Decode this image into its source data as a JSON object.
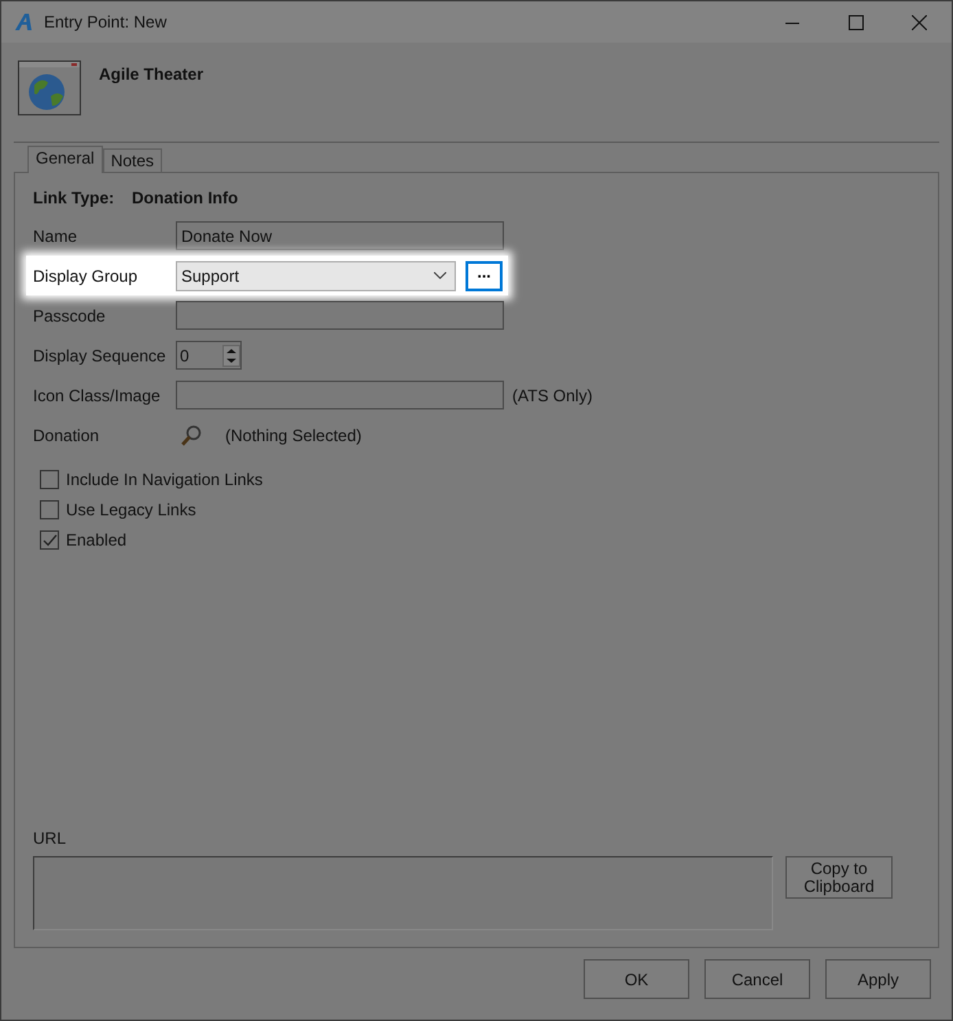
{
  "window": {
    "title": "Entry Point: New"
  },
  "header": {
    "title": "Agile Theater"
  },
  "tabs": [
    {
      "label": "General",
      "selected": true
    },
    {
      "label": "Notes",
      "selected": false
    }
  ],
  "link_type": {
    "label": "Link Type:",
    "value": "Donation Info"
  },
  "fields": [
    {
      "kind": "text",
      "label": "Name",
      "value": "Donate Now",
      "highlighted": false
    },
    {
      "kind": "combo",
      "label": "Display Group",
      "value": "Support",
      "button": "...",
      "highlighted": true
    },
    {
      "kind": "text",
      "label": "Passcode",
      "highlighted": false
    },
    {
      "kind": "spinner",
      "label": "Display Sequence",
      "value": "0",
      "highlighted": false
    },
    {
      "kind": "text",
      "label": "Icon Class/Image",
      "suffix": "(ATS Only)",
      "highlighted": false
    },
    {
      "kind": "lookup",
      "label": "Donation",
      "value": "(Nothing Selected)",
      "highlighted": false
    }
  ],
  "checkboxes": [
    {
      "label": "Include In Navigation Links",
      "checked": false
    },
    {
      "label": "Use Legacy Links",
      "checked": false
    },
    {
      "label": "Enabled",
      "checked": true
    }
  ],
  "url": {
    "label": "URL",
    "copy_button": "Copy to Clipboard"
  },
  "buttons": [
    "OK",
    "Cancel",
    "Apply"
  ]
}
